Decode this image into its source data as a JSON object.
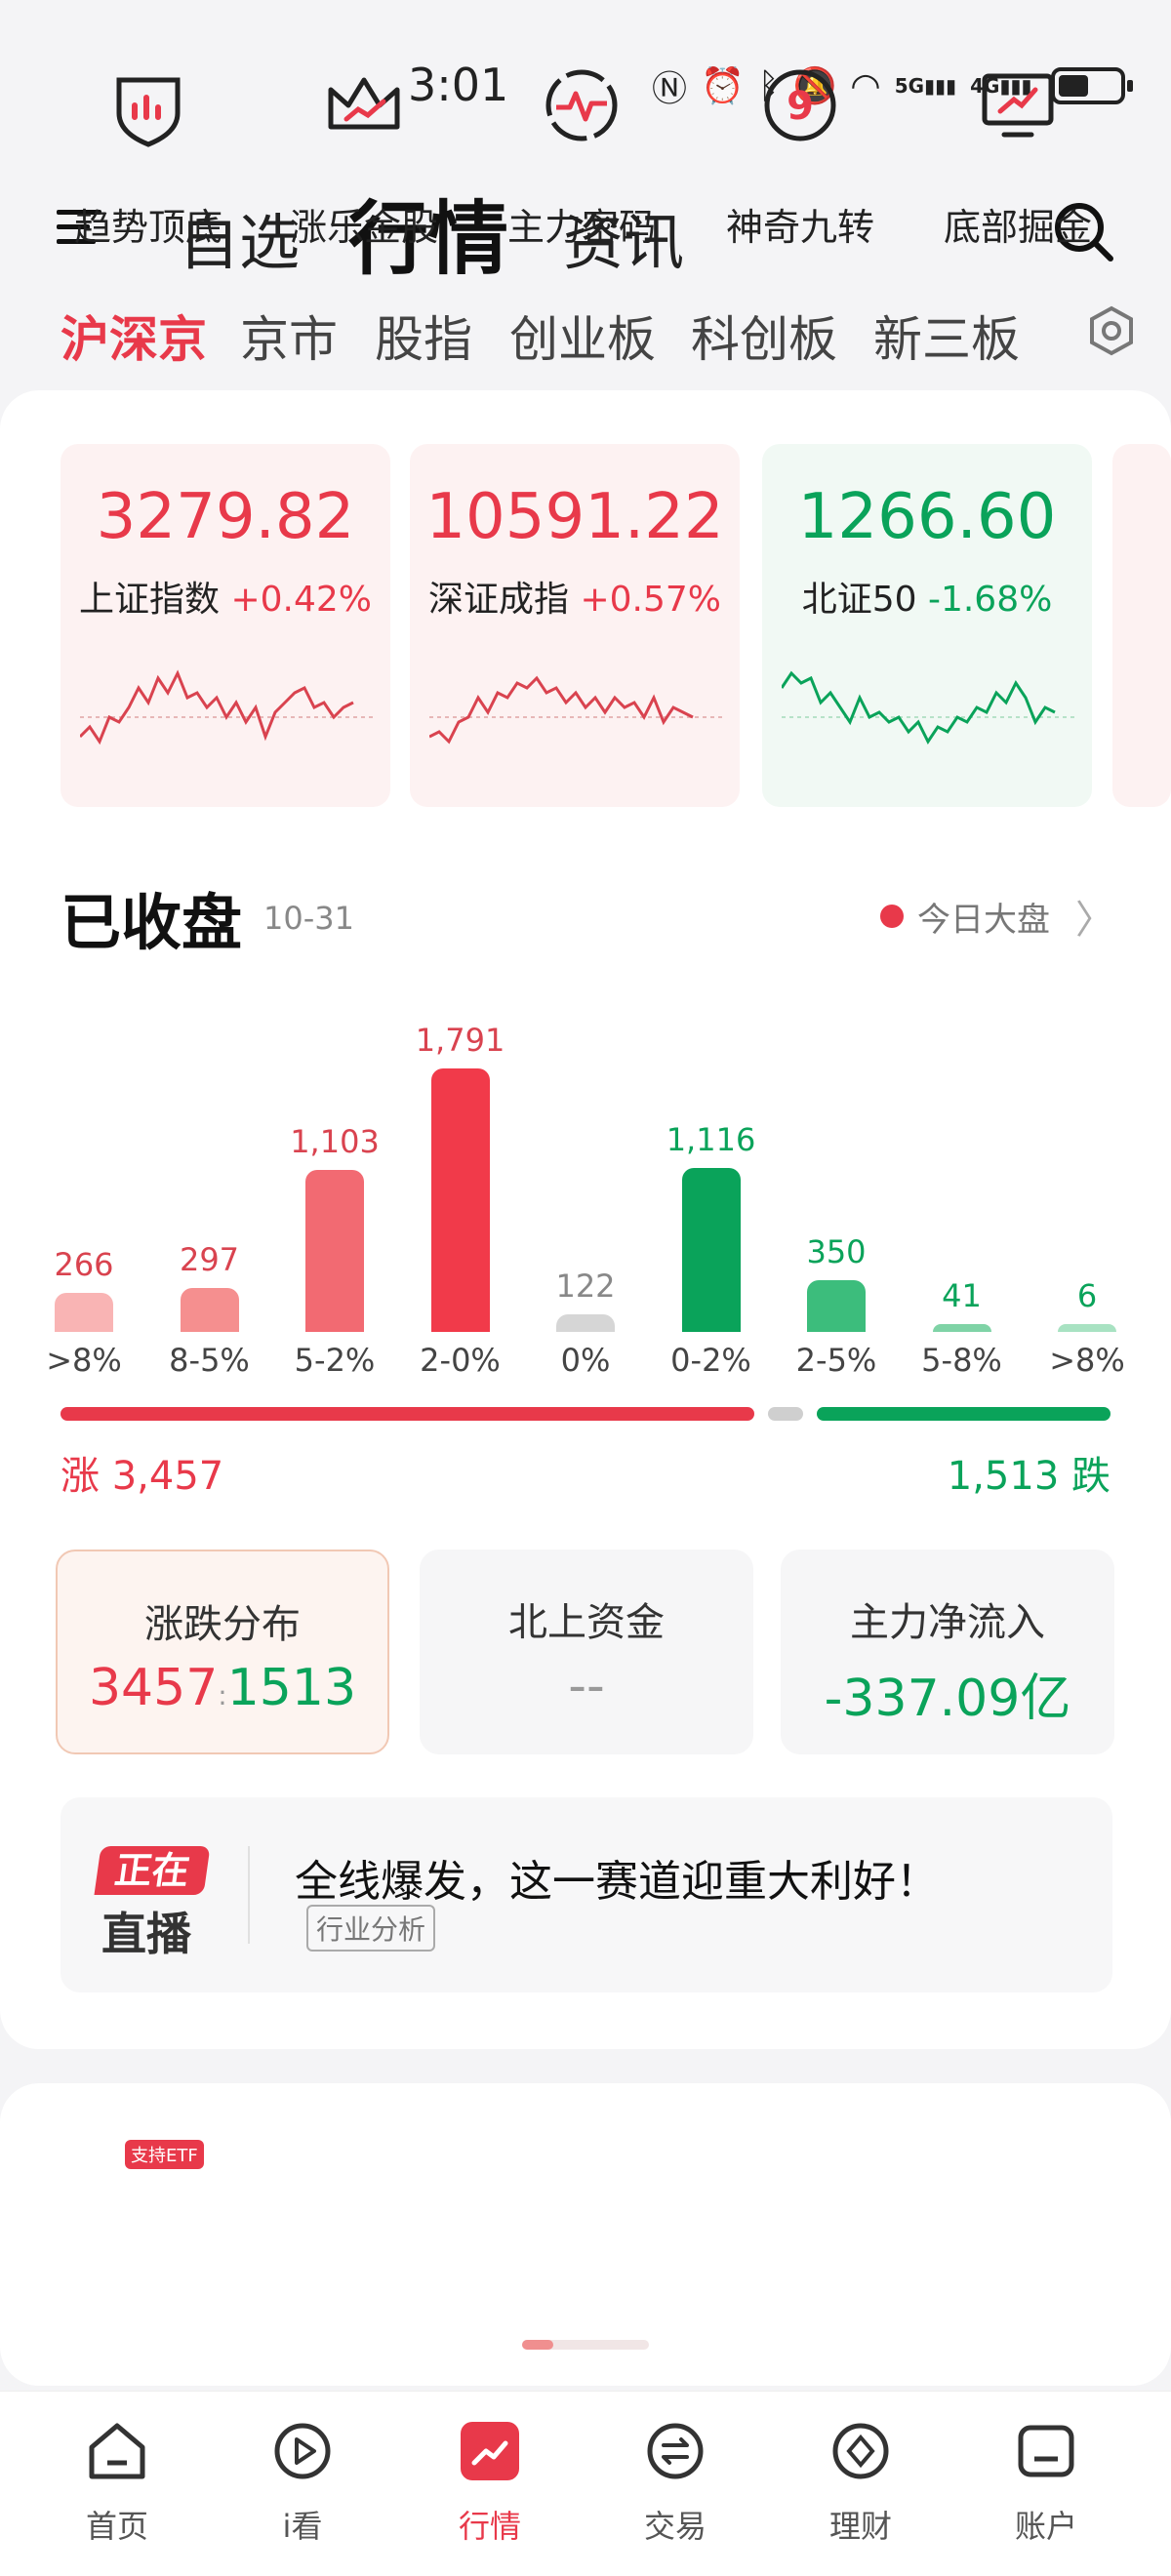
{
  "status": {
    "time": "3:01",
    "net1": "5G",
    "net2": "4G"
  },
  "header": {
    "tabs": [
      "自选",
      "行情",
      "资讯"
    ],
    "active_tab": "行情"
  },
  "subtabs": [
    "沪深京",
    "京市",
    "股指",
    "创业板",
    "科创板",
    "新三板"
  ],
  "indices": [
    {
      "value": "3279.82",
      "name": "上证指数",
      "change": "+0.42%",
      "direction": "up"
    },
    {
      "value": "10591.22",
      "name": "深证成指",
      "change": "+0.57%",
      "direction": "up"
    },
    {
      "value": "1266.60",
      "name": "北证50",
      "change": "-1.68%",
      "direction": "down"
    }
  ],
  "market": {
    "title": "已收盘",
    "date": "10-31",
    "today_link": "今日大盘"
  },
  "chart_data": {
    "type": "bar",
    "categories": [
      ">8%",
      "8-5%",
      "5-2%",
      "2-0%",
      "0%",
      "0-2%",
      "2-5%",
      "5-8%",
      ">8%"
    ],
    "values": [
      266,
      297,
      1103,
      1791,
      122,
      1116,
      350,
      41,
      6
    ],
    "value_labels": [
      "266",
      "297",
      "1,103",
      "1,791",
      "122",
      "1,116",
      "350",
      "41",
      "6"
    ],
    "colors": [
      "#f9b4b4",
      "#f58f8f",
      "#f26a72",
      "#f13a4a",
      "#d6d6d6",
      "#0aa35a",
      "#3cbd7c",
      "#7fd3a6",
      "#a8e2c2"
    ],
    "ylim": [
      0,
      1791
    ]
  },
  "summary": {
    "rise_label": "涨 3,457",
    "fall_label": "1,513 跌",
    "rise": 3457,
    "flat": 122,
    "fall": 1513
  },
  "boxes": [
    {
      "title": "涨跌分布",
      "rise": "3457",
      "fall": "1513"
    },
    {
      "title": "北上资金",
      "value": "--"
    },
    {
      "title": "主力净流入",
      "value": "-337.09亿"
    }
  ],
  "live": {
    "badge_top": "正在",
    "badge_bottom": "直播",
    "title": "全线爆发，这一赛道迎重大利好！",
    "tag": "行业分析"
  },
  "tools": {
    "etf_badge": "支持ETF",
    "items": [
      "趋势顶底",
      "涨乐金股",
      "主力密码",
      "神奇九转",
      "底部掘金"
    ]
  },
  "nav": {
    "items": [
      "首页",
      "i看",
      "行情",
      "交易",
      "理财",
      "账户"
    ],
    "active": "行情"
  }
}
